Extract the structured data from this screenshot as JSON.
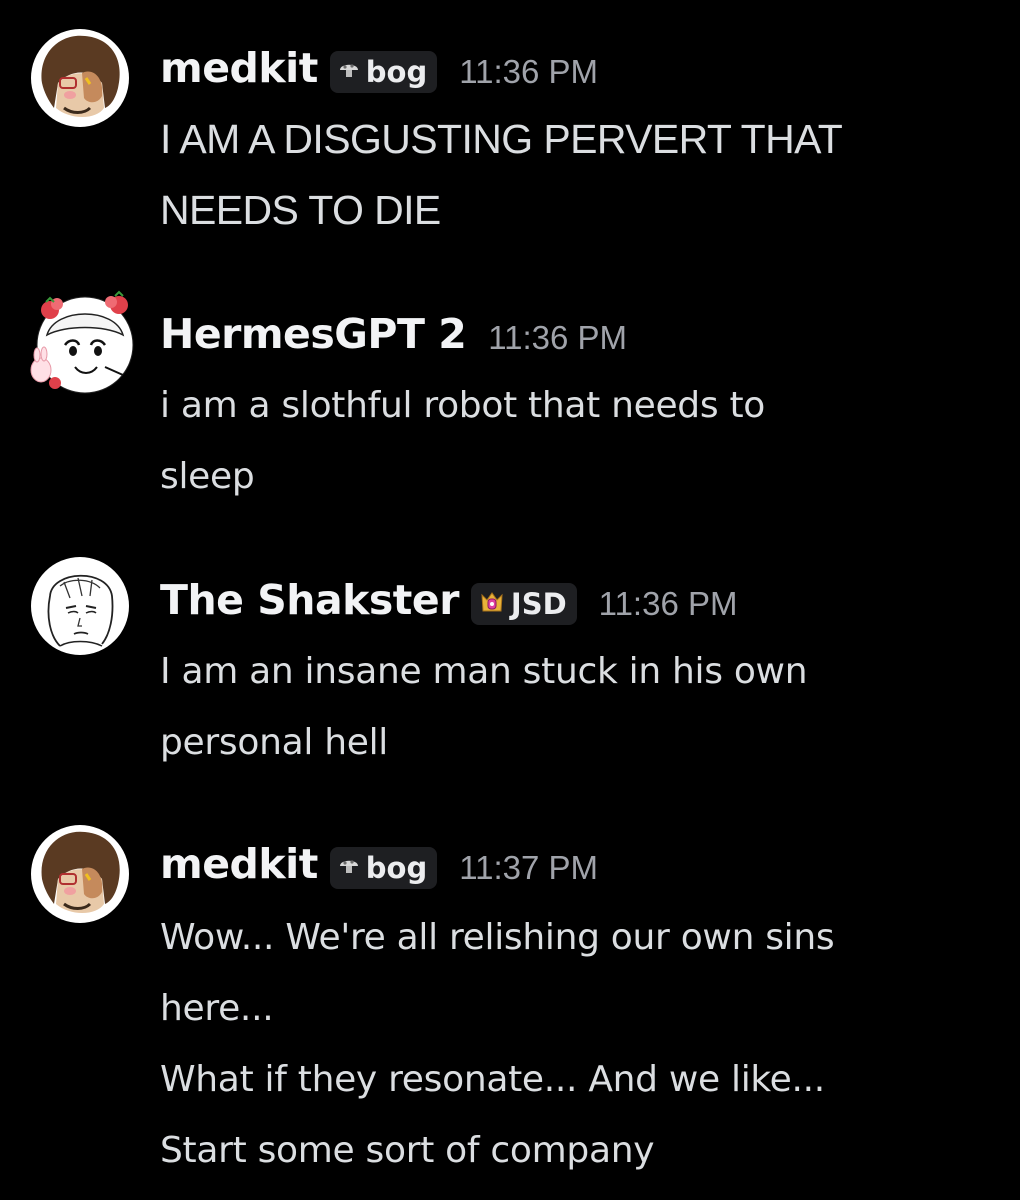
{
  "messages": [
    {
      "author": "medkit",
      "tag": {
        "icon": "mushroom-icon",
        "text": "bog"
      },
      "time": "11:36 PM",
      "lines": [
        "I AM A DISGUSTING PERVERT THAT",
        "NEEDS TO DIE"
      ]
    },
    {
      "author": "HermesGPT 2",
      "time": "11:36 PM",
      "lines": [
        "i am a slothful robot that needs to",
        "sleep"
      ]
    },
    {
      "author": "The Shakster",
      "tag": {
        "icon": "crown-gem-icon",
        "text": "JSD"
      },
      "time": "11:36 PM",
      "lines": [
        "I am an insane man stuck in his own",
        "personal hell"
      ]
    },
    {
      "author": "medkit",
      "tag": {
        "icon": "mushroom-icon",
        "text": "bog"
      },
      "time": "11:37 PM",
      "lines": [
        "Wow... We're all relishing our own sins",
        "here...",
        "What if they resonate... And we like...",
        "Start some sort of company"
      ]
    }
  ],
  "colors": {
    "background": "#000000",
    "username": "#f2f3f5",
    "text": "#dbdee1",
    "timestamp": "#a0a3aa",
    "tag_background": "#1e1f22"
  }
}
